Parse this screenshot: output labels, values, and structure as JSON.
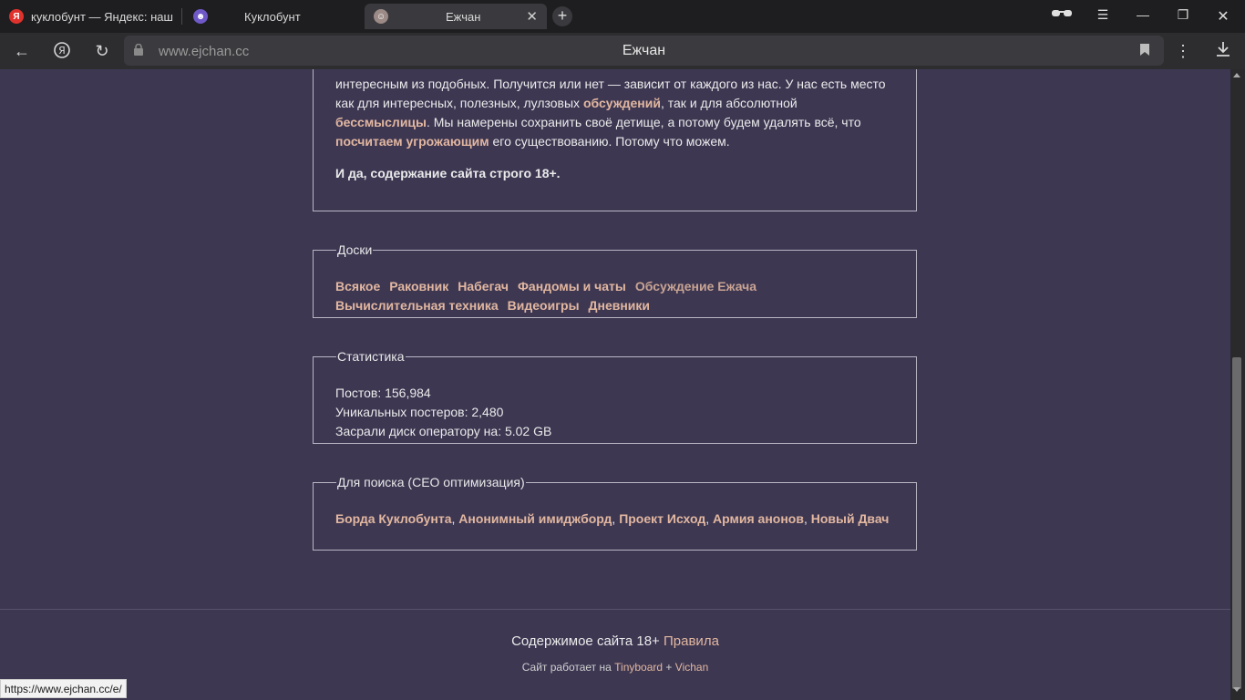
{
  "browser": {
    "tabs": [
      {
        "label": "куклобунт — Яндекс: наш",
        "favicon": "yandex-icon"
      },
      {
        "label": "Куклобунт",
        "favicon": "kuklobunt-icon"
      },
      {
        "label": "Ежчан",
        "favicon": "ejchan-icon",
        "active": true
      }
    ],
    "new_tab": "+",
    "address": {
      "url": "www.ejchan.cc",
      "page_title": "Ежчан"
    },
    "status_url": "https://www.ejchan.cc/e/"
  },
  "intro": {
    "text_a": "интересным из подобных. Получится или нет — зависит от каждого из нас. У нас есть место как для интересных, полезных, лулзовых ",
    "link_a": "обсуждений",
    "text_b": ", так и для абсолютной ",
    "link_b": "бессмыслицы",
    "text_c": ". Мы намерены сохранить своё детище, а потому будем удалять всё, что ",
    "link_c": "посчитаем угрожающим",
    "text_d": " его существованию. Потому что можем.",
    "warning": "И да, содержание сайта строго 18+."
  },
  "boards": {
    "legend": "Доски",
    "row1": [
      "Всякое",
      "Раковник",
      "Набегач",
      "Фандомы и чаты",
      "Обсуждение Ежача"
    ],
    "row2": [
      "Вычислительная техника",
      "Видеоигры",
      "Дневники"
    ]
  },
  "stats": {
    "legend": "Статистика",
    "posts": "Постов: 156,984",
    "posters": "Уникальных постеров: 2,480",
    "disk": "Засрали диск оператору на: 5.02 GB"
  },
  "seo": {
    "legend": "Для поиска (СЕО оптимизация)",
    "links": [
      "Борда Куклобунта",
      "Анонимный имиджборд",
      "Проект Исход",
      "Армия анонов",
      "Новый Двач"
    ]
  },
  "footer": {
    "content_text": "Содержимое сайта 18+",
    "rules_link": "Правила",
    "powered_text": "Сайт работает на",
    "tinyboard": "Tinyboard",
    "plus": "+",
    "vichan": "Vichan"
  },
  "colors": {
    "background": "#3d3752",
    "link": "#e2b7a0",
    "warning": "#ff4a4a"
  }
}
